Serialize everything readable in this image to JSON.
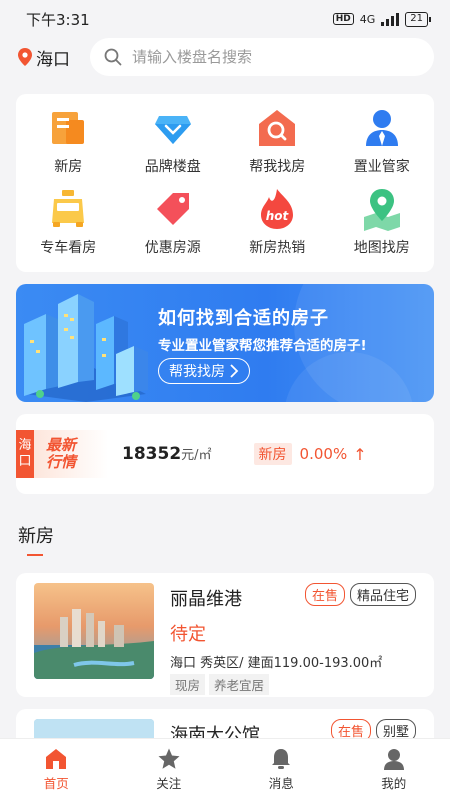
{
  "status": {
    "time": "下午3:31",
    "hd": "HD",
    "network": "4G",
    "battery": "21"
  },
  "header": {
    "city": "海口",
    "search_placeholder": "请输入楼盘名搜索"
  },
  "grid": [
    {
      "label": "新房",
      "icon": "new-house-icon"
    },
    {
      "label": "品牌楼盘",
      "icon": "brand-diamond-icon"
    },
    {
      "label": "帮我找房",
      "icon": "house-search-icon"
    },
    {
      "label": "置业管家",
      "icon": "agent-icon"
    },
    {
      "label": "专车看房",
      "icon": "car-icon"
    },
    {
      "label": "优惠房源",
      "icon": "discount-tag-icon"
    },
    {
      "label": "新房热销",
      "icon": "hot-flame-icon"
    },
    {
      "label": "地图找房",
      "icon": "map-pin-icon"
    }
  ],
  "banner": {
    "title": "如何找到合适的房子",
    "subtitle": "专业置业管家帮您推荐合适的房子!",
    "button": "帮我找房"
  },
  "market": {
    "tag_top": "海",
    "tag_bottom": "口",
    "logo_line1": "最新",
    "logo_line2": "行情",
    "price": "18352",
    "unit": "元/㎡",
    "type": "新房",
    "change": "0.00%",
    "arrow": "↑"
  },
  "section": {
    "title": "新房"
  },
  "listings": [
    {
      "name": "丽晶维港",
      "status": "在售",
      "category": "精品住宅",
      "price": "待定",
      "address": "海口 秀英区/ 建面119.00-193.00㎡",
      "tags": [
        "现房",
        "养老宜居"
      ]
    },
    {
      "name": "海南大公馆",
      "status": "在售",
      "category": "别墅"
    }
  ],
  "tabbar": [
    {
      "label": "首页",
      "icon": "home-icon",
      "active": true
    },
    {
      "label": "关注",
      "icon": "star-icon",
      "active": false
    },
    {
      "label": "消息",
      "icon": "bell-icon",
      "active": false
    },
    {
      "label": "我的",
      "icon": "user-icon",
      "active": false
    }
  ],
  "colors": {
    "accent": "#f25532",
    "banner": "#2f7cf0",
    "background": "#f4f4f6"
  }
}
